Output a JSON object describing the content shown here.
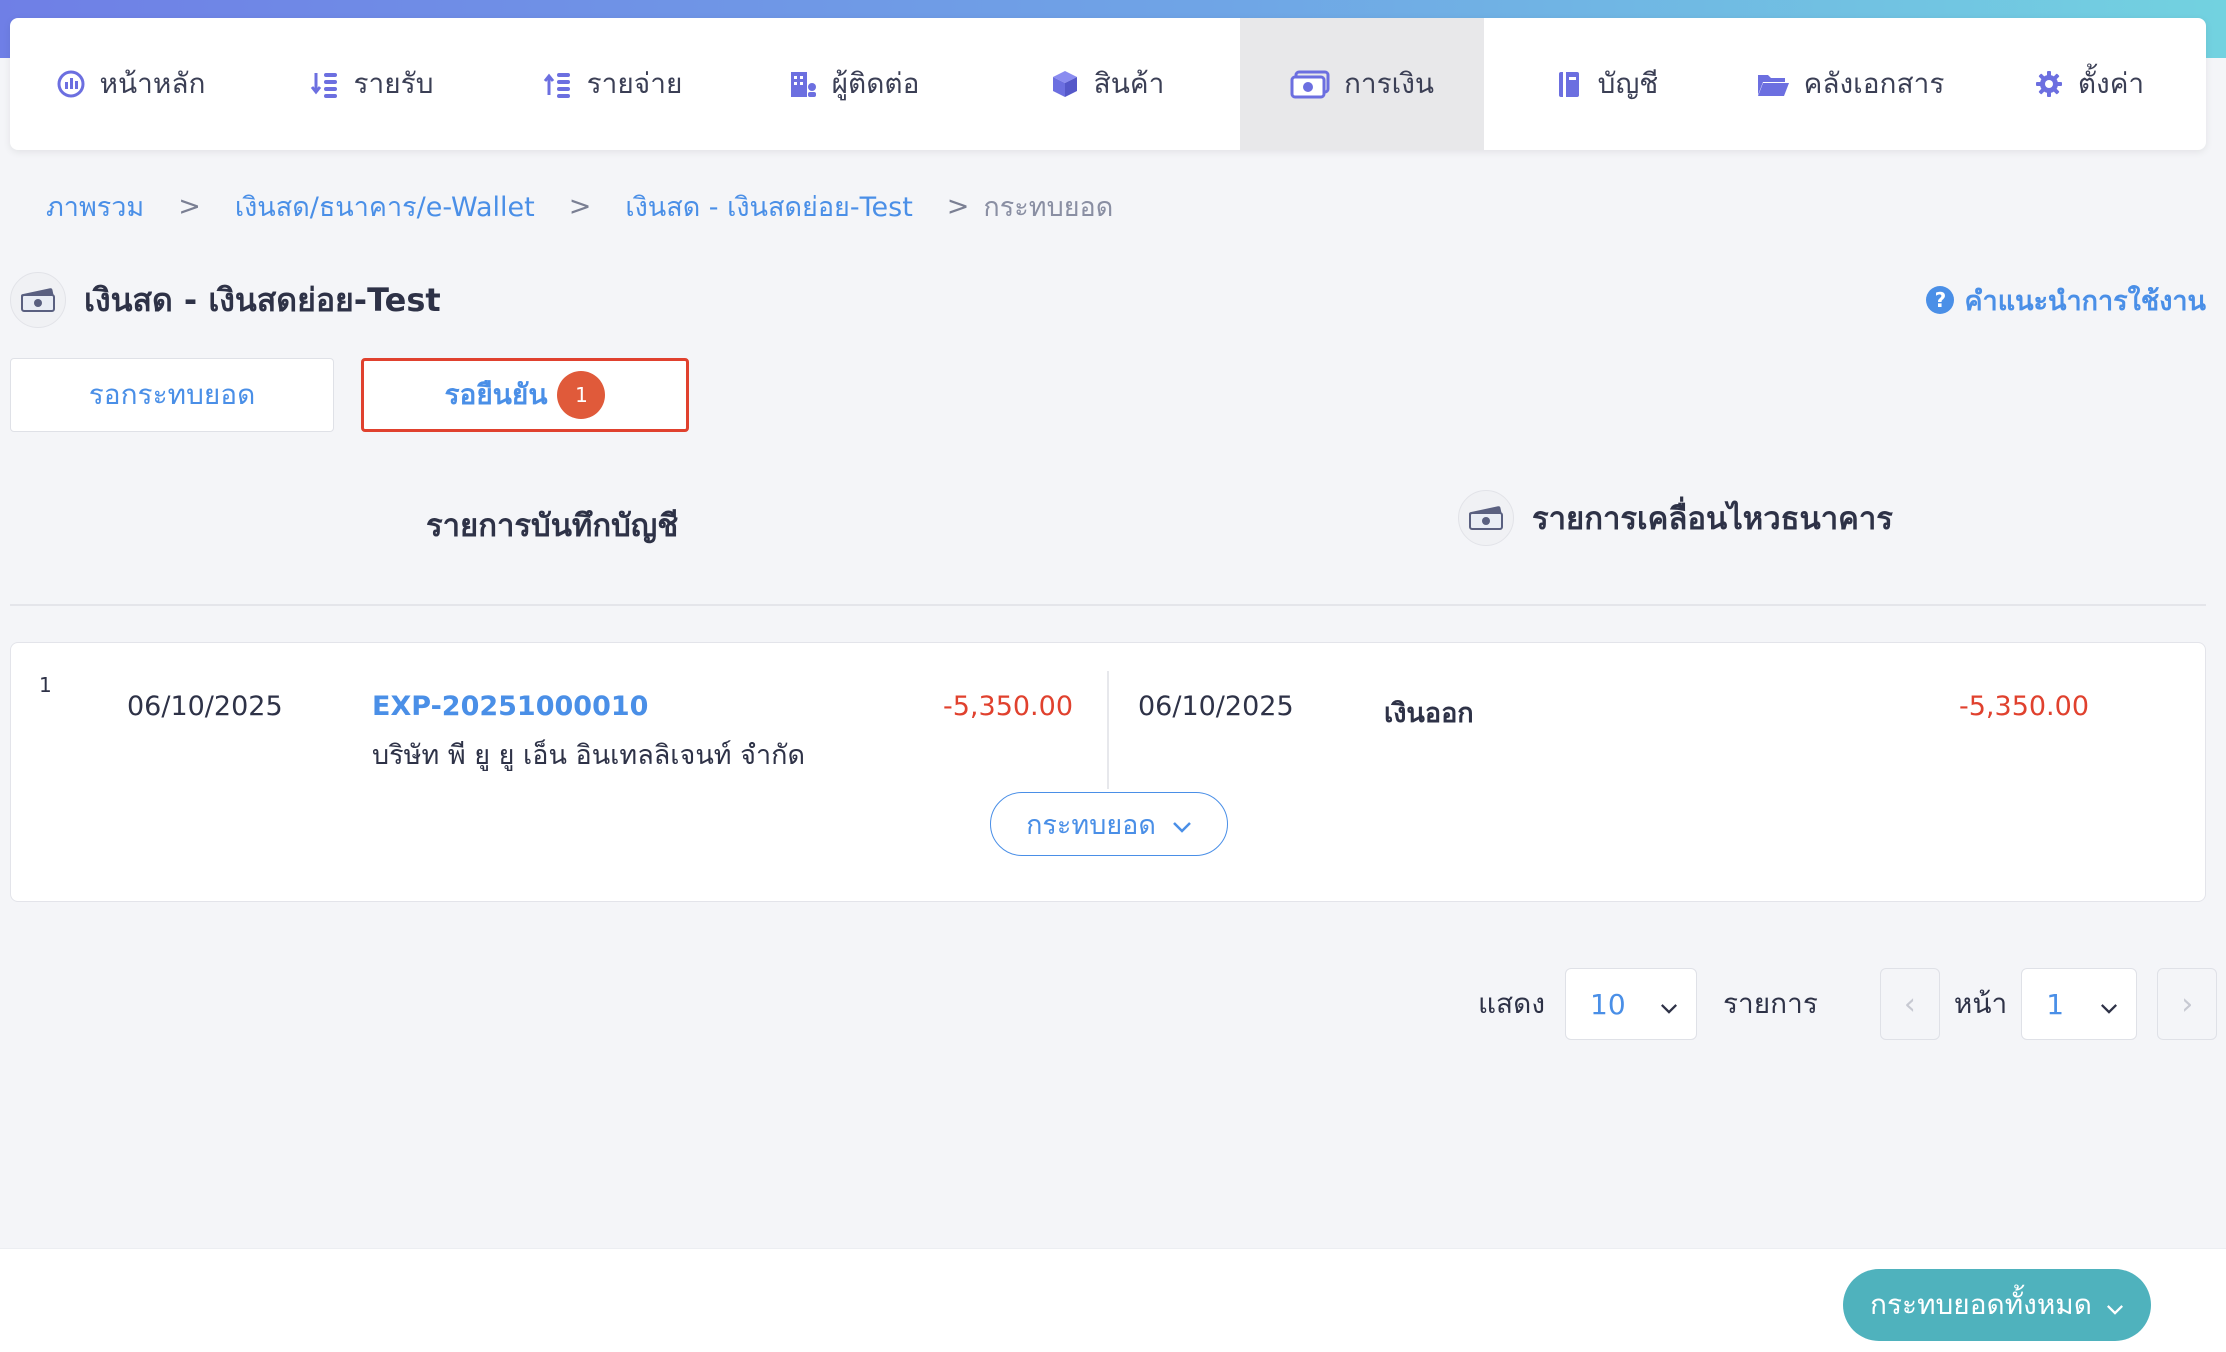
{
  "nav": {
    "items": [
      {
        "label": "หน้าหลัก",
        "icon": "dashboard-icon"
      },
      {
        "label": "รายรับ",
        "icon": "income-icon"
      },
      {
        "label": "รายจ่าย",
        "icon": "expense-icon"
      },
      {
        "label": "ผู้ติดต่อ",
        "icon": "contacts-icon"
      },
      {
        "label": "สินค้า",
        "icon": "product-box-icon"
      },
      {
        "label": "การเงิน",
        "icon": "money-icon",
        "active": true
      },
      {
        "label": "บัญชี",
        "icon": "ledger-book-icon"
      },
      {
        "label": "คลังเอกสาร",
        "icon": "folder-icon"
      },
      {
        "label": "ตั้งค่า",
        "icon": "gear-icon"
      }
    ]
  },
  "breadcrumb": {
    "items": [
      "ภาพรวม",
      "เงินสด/ธนาคาร/e-Wallet",
      "เงินสด - เงินสดย่อย-Test"
    ],
    "current": "กระทบยอด",
    "separator": ">"
  },
  "header": {
    "title": "เงินสด - เงินสดย่อย-Test",
    "help_label": "คำแนะนำการใช้งาน",
    "help_icon_text": "?"
  },
  "tabs": {
    "pending_label": "รอกระทบยอด",
    "confirm_label": "รอยืนยัน",
    "confirm_badge": "1"
  },
  "sections": {
    "ledger_title": "รายการบันทึกบัญชี",
    "bank_title": "รายการเคลื่อนไหวธนาคาร"
  },
  "match": {
    "row_number": "1",
    "left": {
      "date": "06/10/2025",
      "doc_no": "EXP-20251000010",
      "contact": "บริษัท พี ยู ยู เอ็น อินเทลลิเจนท์ จำกัด",
      "amount": "-5,350.00"
    },
    "right": {
      "date": "06/10/2025",
      "type": "เงินออก",
      "amount": "-5,350.00"
    },
    "reconcile_label": "กระทบยอด"
  },
  "pagination": {
    "show_label": "แสดง",
    "page_size": "10",
    "items_label": "รายการ",
    "page_label": "หน้า",
    "current_page": "1",
    "prev": "‹",
    "next": "›"
  },
  "footer": {
    "reconcile_all_label": "กระทบยอดทั้งหมด"
  },
  "colors": {
    "accent": "#4a8fe7",
    "negative": "#e0412e",
    "badge": "#e05a3a",
    "primary_button": "#4fb2bd"
  }
}
